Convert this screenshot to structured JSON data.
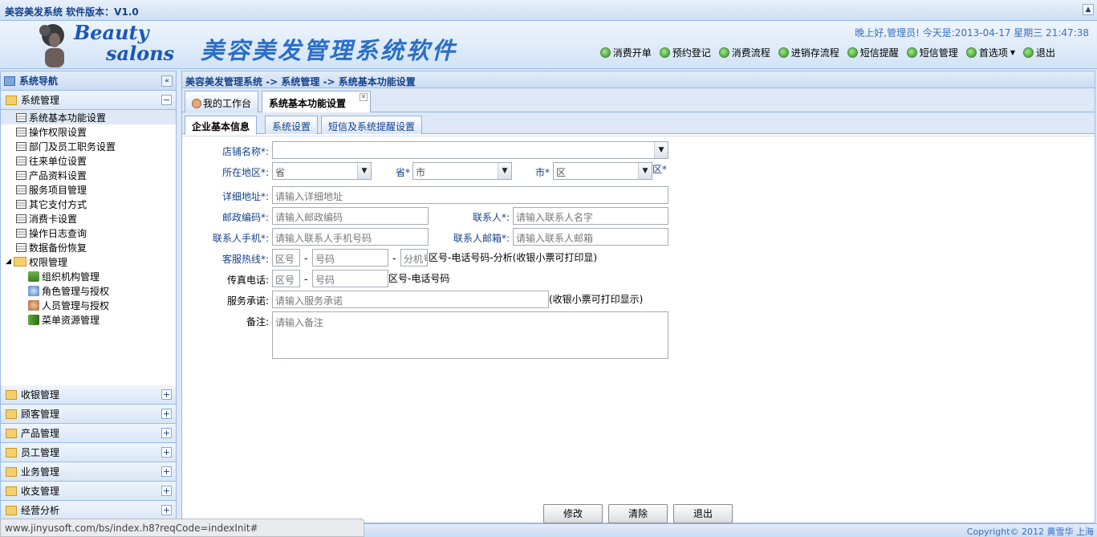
{
  "titlebar": {
    "text": "美容美发系统 软件版本：V1.0"
  },
  "header": {
    "logo_line1": "Beauty",
    "logo_line2": "salons",
    "slogan": "美容美发管理系统软件",
    "greeting": "晚上好,管理员! 今天是:2013-04-17 星期三 21:47:38",
    "nav": [
      "消费开单",
      "预约登记",
      "消费流程",
      "进销存流程",
      "短信提醒",
      "短信管理",
      "首选项",
      "退出"
    ]
  },
  "sidebar": {
    "title": "系统导航",
    "section_open": "系统管理",
    "items": [
      "系统基本功能设置",
      "操作权限设置",
      "部门及员工职务设置",
      "往来单位设置",
      "产品资料设置",
      "服务项目管理",
      "其它支付方式",
      "消费卡设置",
      "操作日志查询",
      "数据备份恢复"
    ],
    "folder": "权限管理",
    "sub_items": [
      "组织机构管理",
      "角色管理与授权",
      "人员管理与授权",
      "菜单资源管理"
    ],
    "sections": [
      "收银管理",
      "顾客管理",
      "产品管理",
      "员工管理",
      "业务管理",
      "收支管理",
      "经营分析"
    ]
  },
  "breadcrumb": "美容美发管理系统 -> 系统管理 -> 系统基本功能设置",
  "tabs": {
    "home": "我的工作台",
    "current": "系统基本功能设置"
  },
  "subtabs": [
    "企业基本信息",
    "系统设置",
    "短信及系统提醒设置"
  ],
  "form": {
    "shop_name_label": "店铺名称",
    "region_label": "所在地区",
    "province_placeholder": "省",
    "province_label": "省",
    "city_placeholder": "市",
    "city_label": "市",
    "district_placeholder": "区",
    "district_label": "区",
    "address_label": "详细地址",
    "address_placeholder": "请输入详细地址",
    "postcode_label": "邮政编码",
    "postcode_placeholder": "请输入邮政编码",
    "contact_label": "联系人",
    "contact_placeholder": "请输入联系人名字",
    "mobile_label": "联系人手机",
    "mobile_placeholder": "请输入联系人手机号码",
    "email_label": "联系人邮箱",
    "email_placeholder": "请输入联系人邮箱",
    "hotline_label": "客服热线",
    "area_placeholder": "区号",
    "number_placeholder": "号码",
    "ext_placeholder": "分机号",
    "hotline_note": "区号-电话号码-分析(收银小票可打印显)",
    "fax_label": "传真电话:",
    "fax_note": "区号-电话号码",
    "promise_label": "服务承诺:",
    "promise_placeholder": "请输入服务承诺",
    "promise_note": "(收银小票可打印显示)",
    "remark_label": "备注:",
    "remark_placeholder": "请输入备注",
    "required_mark": "*",
    "colon": ":",
    "dash": "-"
  },
  "buttons": {
    "edit": "修改",
    "clear": "清除",
    "exit": "退出"
  },
  "status_url": "www.jinyusoft.com/bs/index.h8?reqCode=indexInit#",
  "footer": "Copyright© 2012 黄雪华 上海"
}
